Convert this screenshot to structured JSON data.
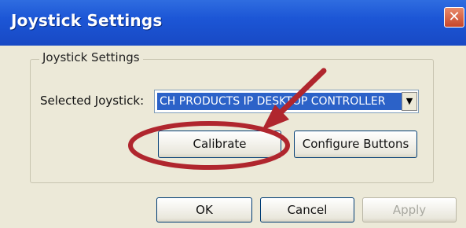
{
  "window": {
    "title": "Joystick Settings",
    "close_glyph": "✕"
  },
  "group": {
    "label": "Joystick Settings"
  },
  "selected_joystick": {
    "label": "Selected Joystick:",
    "value": "CH PRODUCTS IP DESKTOP CONTROLLER",
    "arrow_glyph": "▼"
  },
  "buttons": {
    "calibrate": "Calibrate",
    "configure": "Configure Buttons"
  },
  "footer": {
    "ok": "OK",
    "cancel": "Cancel",
    "apply": "Apply"
  },
  "annotation": {
    "color": "#b0262e",
    "arrow": "arrow-pointing-at-calibrate",
    "highlight": "circle-around-calibrate"
  }
}
